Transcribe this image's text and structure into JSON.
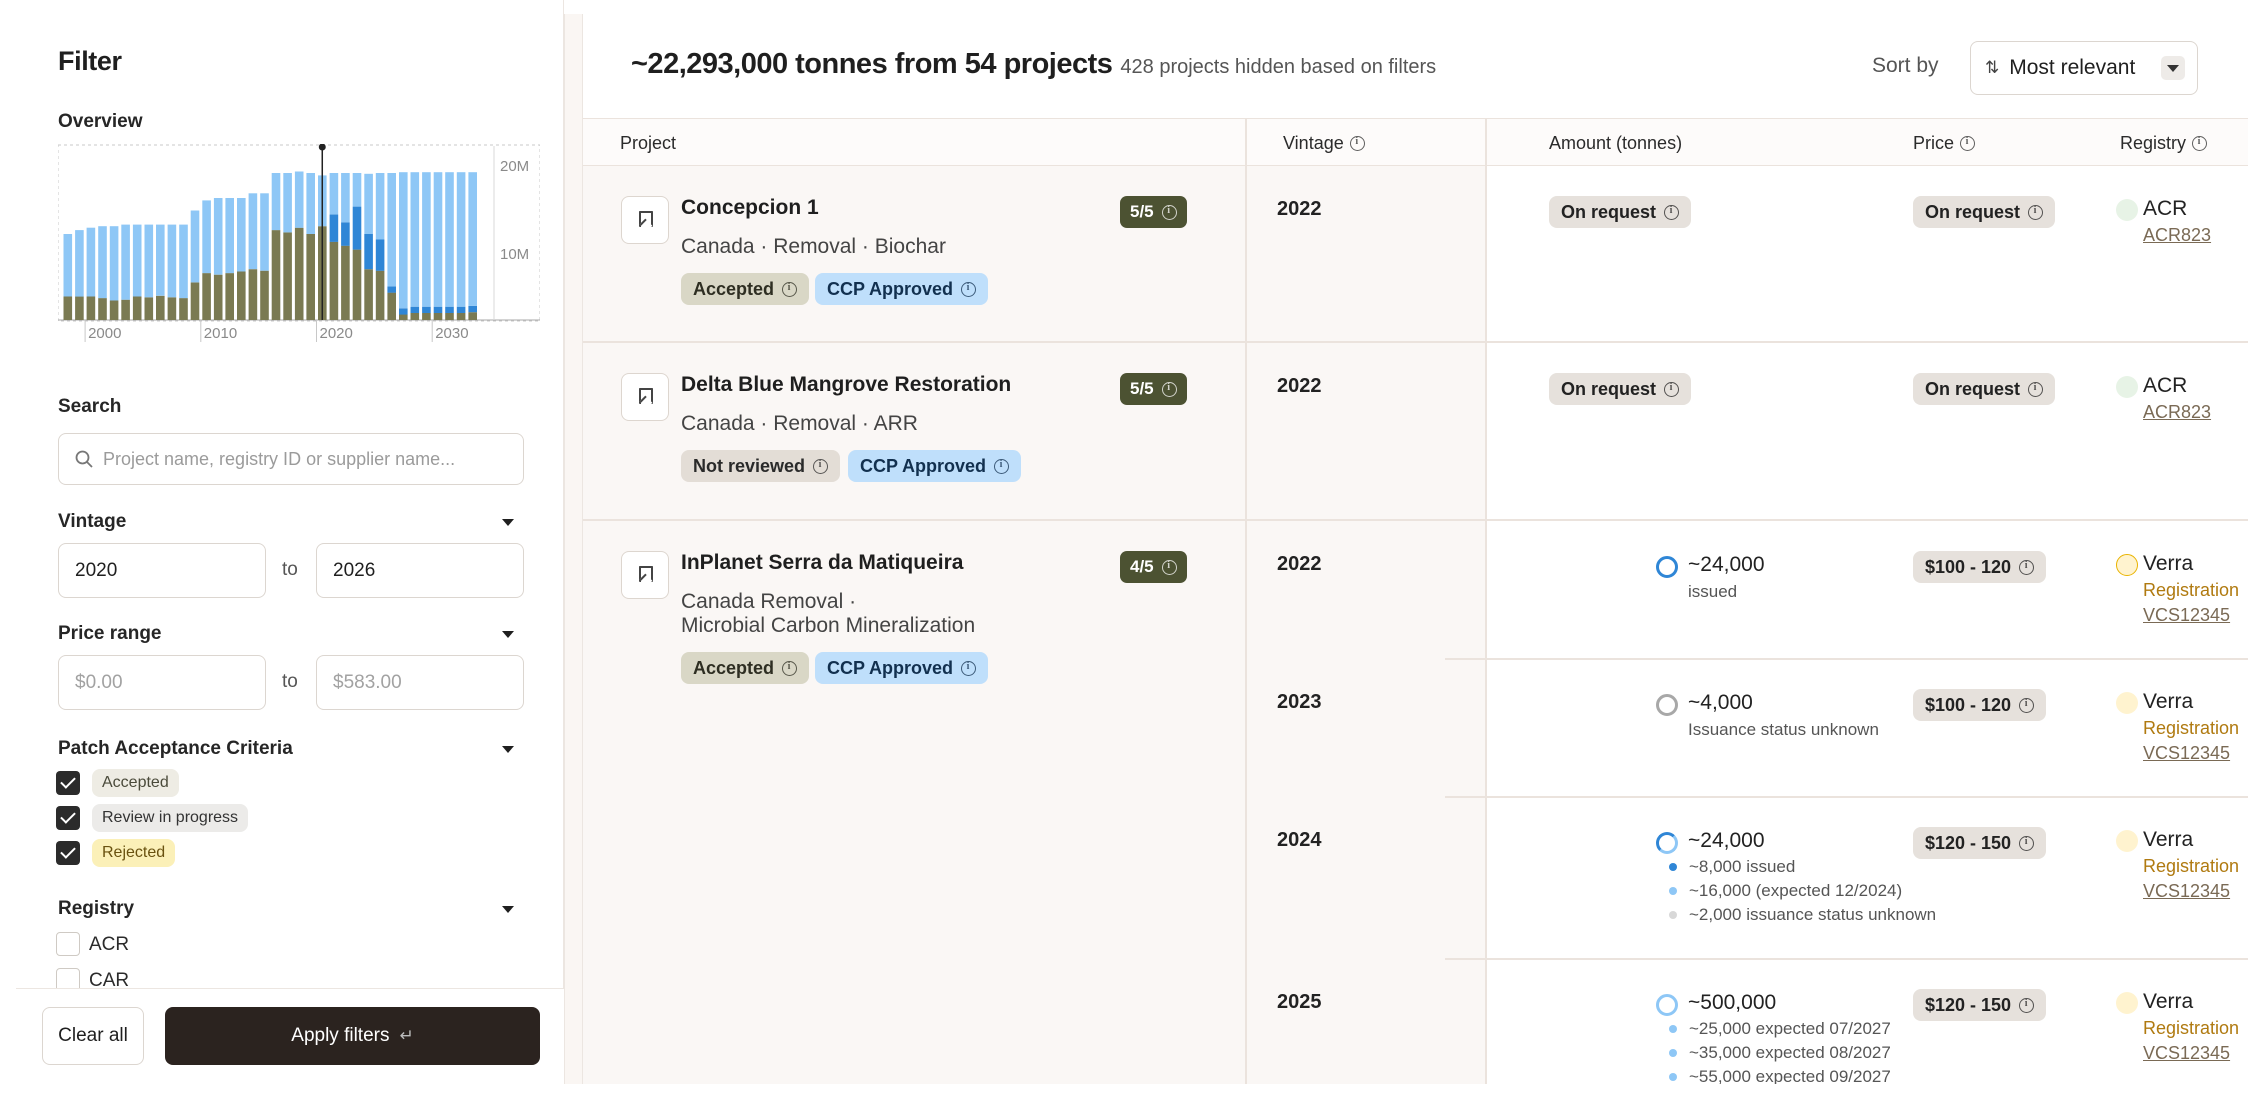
{
  "sidebar": {
    "title": "Filter",
    "overview_label": "Overview",
    "chart_axis": {
      "y_top": "20M",
      "y_mid": "10M",
      "x": [
        "2000",
        "2010",
        "2020",
        "2030"
      ]
    },
    "search_label": "Search",
    "search_placeholder": "Project name, registry ID or supplier name...",
    "vintage_label": "Vintage",
    "vintage_from": "2020",
    "vintage_to": "2026",
    "to": "to",
    "price_label": "Price range",
    "price_from_placeholder": "$0.00",
    "price_to_placeholder": "$583.00",
    "criteria_label": "Patch Acceptance Criteria",
    "criteria": [
      {
        "label": "Accepted",
        "checked": true
      },
      {
        "label": "Review in progress",
        "checked": true
      },
      {
        "label": "Rejected",
        "checked": true
      }
    ],
    "registry_label": "Registry",
    "registries": [
      {
        "label": "ACR",
        "checked": false
      },
      {
        "label": "CAR",
        "checked": false
      }
    ],
    "clear_all": "Clear all",
    "apply_filters": "Apply filters",
    "apply_enter_glyph": "↵"
  },
  "chart_data": {
    "type": "bar",
    "stacked": true,
    "x": [
      1998,
      1999,
      2000,
      2001,
      2002,
      2003,
      2004,
      2005,
      2006,
      2007,
      2008,
      2009,
      2010,
      2011,
      2012,
      2013,
      2014,
      2015,
      2016,
      2017,
      2018,
      2019,
      2020,
      2021,
      2022,
      2023,
      2024,
      2025,
      2026,
      2027,
      2028,
      2029,
      2030,
      2031,
      2032,
      2033,
      2034
    ],
    "series": [
      {
        "color": "#7a7a52",
        "values": [
          3.0,
          3.0,
          3.0,
          2.8,
          2.5,
          2.6,
          3.0,
          2.9,
          3.1,
          2.9,
          2.8,
          4.8,
          6.0,
          5.8,
          6.0,
          6.2,
          6.5,
          6.3,
          11.5,
          11.2,
          11.8,
          11.0,
          12.0,
          10.0,
          9.5,
          9.0,
          6.5,
          6.3,
          3.5,
          0.7,
          0.9,
          0.9,
          0.9,
          0.9,
          0.9,
          1.0,
          0.0
        ]
      },
      {
        "color": "#2f86d6",
        "values": [
          0,
          0,
          0,
          0,
          0,
          0,
          0,
          0,
          0,
          0,
          0,
          0,
          0,
          0,
          0,
          0,
          0,
          0,
          0,
          0,
          0,
          0,
          0,
          3.5,
          3.0,
          5.5,
          4.5,
          4.0,
          0.8,
          0.8,
          0.8,
          0.8,
          0.8,
          0.8,
          0.8,
          0.8,
          0
        ]
      },
      {
        "color": "#8ec7f6",
        "values": [
          8.0,
          8.5,
          8.8,
          9.2,
          9.5,
          9.6,
          9.2,
          9.3,
          9.1,
          9.3,
          9.4,
          9.2,
          9.3,
          9.8,
          9.6,
          9.4,
          9.7,
          9.9,
          7.3,
          7.6,
          7.2,
          7.8,
          6.5,
          5.3,
          6.3,
          4.3,
          7.7,
          8.5,
          14.5,
          17.4,
          17.2,
          17.2,
          17.2,
          17.2,
          17.2,
          17.1,
          0
        ]
      }
    ],
    "ylim": [
      0,
      22
    ],
    "yticks": [
      "10M",
      "20M"
    ],
    "xticks": [
      "2000",
      "2010",
      "2020",
      "2030"
    ]
  },
  "main": {
    "summary_big": "~22,293,000 tonnes from 54 projects",
    "summary_small": "428 projects hidden based on filters",
    "sort_label": "Sort by",
    "sort_value": "Most relevant",
    "columns": {
      "project": "Project",
      "vintage": "Vintage",
      "amount": "Amount (tonnes)",
      "price": "Price",
      "registry": "Registry"
    },
    "projects": [
      {
        "name": "Concepcion 1",
        "meta": "Canada · Removal · Biochar",
        "score": "5/5",
        "chips": [
          "Accepted",
          "CCP Approved"
        ],
        "vintage": "2022",
        "amount": "On request",
        "price": "On request",
        "registry": "ACR",
        "registry_id": "ACR823"
      },
      {
        "name": "Delta Blue Mangrove Restoration",
        "meta": "Canada · Removal · ARR",
        "score": "5/5",
        "chips": [
          "Not reviewed",
          "CCP Approved"
        ],
        "vintage": "2022",
        "amount": "On request",
        "price": "On request",
        "registry": "ACR",
        "registry_id": "ACR823"
      },
      {
        "name": "InPlanet Serra da Matiqueira",
        "meta_line1": "Canada  Removal ·",
        "meta_line2": "Microbial Carbon Mineralization",
        "score": "4/5",
        "chips": [
          "Accepted",
          "CCP Approved"
        ],
        "vintages": [
          {
            "year": "2022",
            "amount": "~24,000",
            "sub": "issued",
            "price": "$100 - 120",
            "registry": "Verra",
            "status": "Registration",
            "registry_id": "VCS12345"
          },
          {
            "year": "2023",
            "amount": "~4,000",
            "sub": "Issuance status unknown",
            "price": "$100 - 120",
            "registry": "Verra",
            "status": "Registration",
            "registry_id": "VCS12345"
          },
          {
            "year": "2024",
            "amount": "~24,000",
            "bullets": [
              "~8,000 issued",
              "~16,000 (expected 12/2024)",
              "~2,000 issuance status unknown"
            ],
            "price": "$120 - 150",
            "registry": "Verra",
            "status": "Registration",
            "registry_id": "VCS12345"
          },
          {
            "year": "2025",
            "amount": "~500,000",
            "bullets": [
              "~25,000 expected 07/2027",
              "~35,000 expected 08/2027",
              "~55,000 expected 09/2027"
            ],
            "price": "$120 - 150",
            "registry": "Verra",
            "status": "Registration",
            "registry_id": "VCS12345"
          }
        ]
      }
    ]
  },
  "colors": {
    "score_bg": "#4c5232",
    "ccp_chip": "#bfdffb",
    "accepted_chip": "#d9d7c6",
    "apply_button": "#2b231f",
    "rejected_chip": "#fbf0b8"
  }
}
